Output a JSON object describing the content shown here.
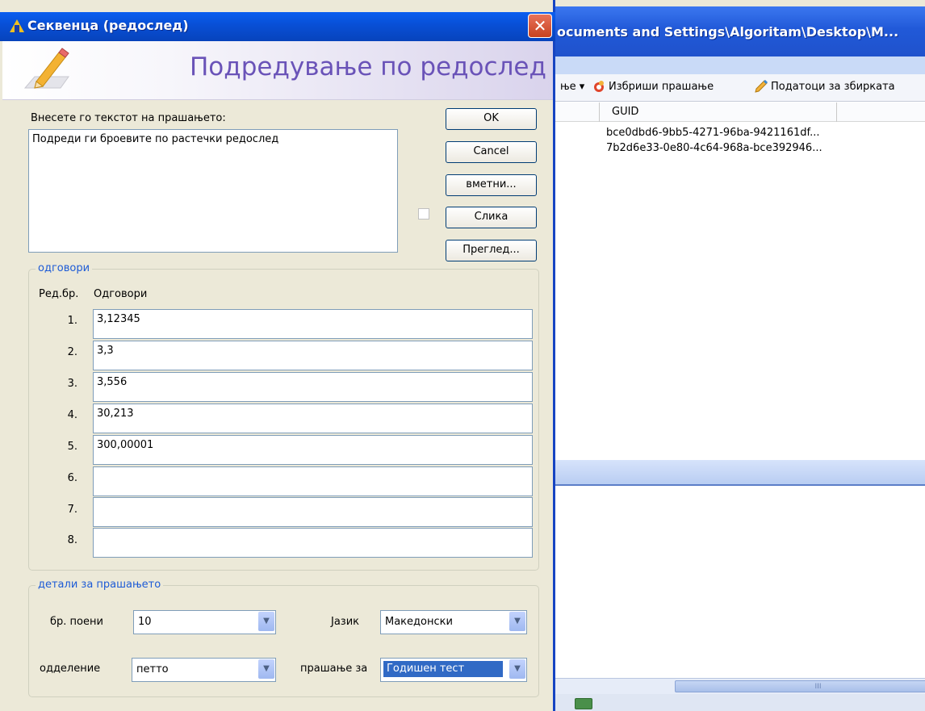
{
  "background_window": {
    "title": "ocuments and Settings\\Algoritam\\Desktop\\M...",
    "toolbar": {
      "item_partial": "ње ▾",
      "delete_question": "Избриши прашање",
      "collection_data": "Податоци за збирката"
    },
    "table": {
      "column_guid": "GUID",
      "rows": [
        "bce0dbd6-9bb5-4271-96ba-9421161df...",
        "7b2d6e33-0e80-4c64-968a-bce392946..."
      ]
    },
    "scroll_grip": "III"
  },
  "dialog": {
    "title": "Секвенца (редослед)",
    "close_symbol": "✕",
    "banner_title": "Подредување по редослед",
    "question_label": "Внесете го текстот на прашањето:",
    "question_text": "Подреди ги броевите по растечки редослед",
    "buttons": {
      "ok": "OK",
      "cancel": "Cancel",
      "insert": "вметни...",
      "picture": "Слика",
      "preview": "Преглед..."
    },
    "answers_group": {
      "title": "одговори",
      "col_num": "Ред.бр.",
      "col_answers": "Одговори",
      "items": [
        {
          "num": "1.",
          "value": "3,12345"
        },
        {
          "num": "2.",
          "value": "3,3"
        },
        {
          "num": "3.",
          "value": "3,556"
        },
        {
          "num": "4.",
          "value": "30,213"
        },
        {
          "num": "5.",
          "value": "300,00001"
        },
        {
          "num": "6.",
          "value": ""
        },
        {
          "num": "7.",
          "value": ""
        },
        {
          "num": "8.",
          "value": ""
        }
      ]
    },
    "details_group": {
      "title": "детали за прашањето",
      "points_label": "бр. поени",
      "points_value": "10",
      "language_label": "Јазик",
      "language_value": "Македонски",
      "grade_label": "одделение",
      "grade_value": "петто",
      "question_for_label": "прашање за",
      "question_for_value": "Годишен тест"
    }
  },
  "colors": {
    "accent_blue": "#1d5bd6",
    "banner_purple": "#6a53b8",
    "dialog_face": "#ece9d8"
  }
}
